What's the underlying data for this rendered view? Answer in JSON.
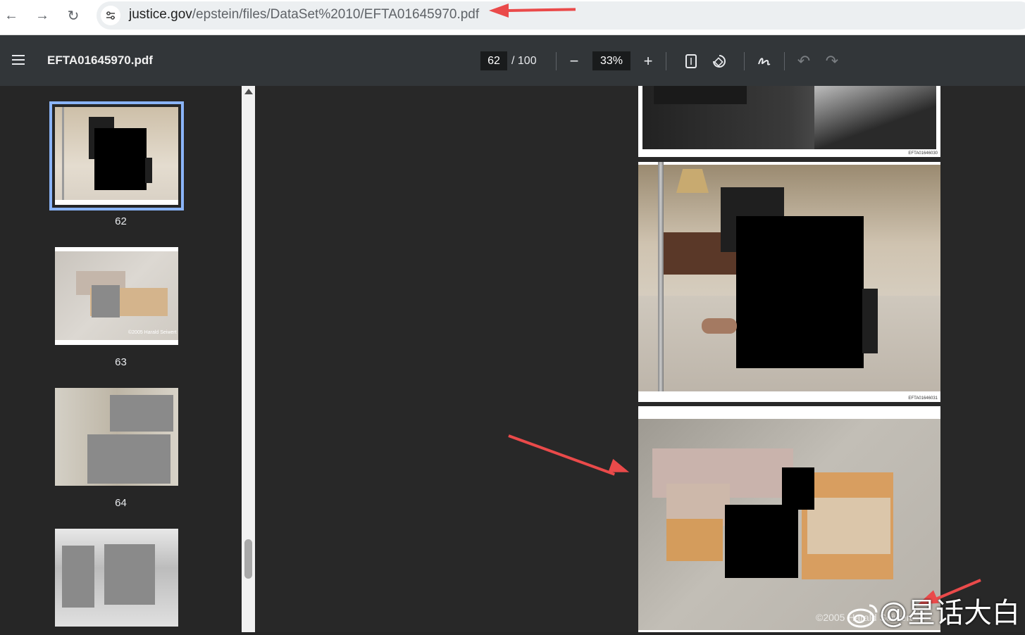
{
  "browser": {
    "url_domain": "justice.gov",
    "url_path": "/epstein/files/DataSet%2010/EFTA01645970.pdf",
    "back_icon": "arrow-left",
    "forward_icon": "arrow-right",
    "reload_icon": "reload",
    "site_info_icon": "tune"
  },
  "viewer": {
    "title": "EFTA01645970.pdf",
    "current_page": "62",
    "total_pages": "/ 100",
    "zoom": "33%",
    "zoom_out_icon": "minus",
    "zoom_in_icon": "plus",
    "fit_icon": "fit-page",
    "rotate_icon": "rotate",
    "annotate_icon": "draw",
    "undo_icon": "undo",
    "redo_icon": "redo"
  },
  "thumbnails": [
    {
      "label": "62",
      "selected": true
    },
    {
      "label": "63",
      "selected": false
    },
    {
      "label": "64",
      "selected": false
    },
    {
      "label": "",
      "selected": false
    }
  ],
  "thumbnail_caption_63": "©2005 Harald Seiwert",
  "pages": [
    {
      "code": "EFTA01646030"
    },
    {
      "code": "EFTA01646031"
    },
    {
      "code": ""
    }
  ],
  "page3_copyright": "©2005 Harald Seiwert",
  "watermark": "@星话大白",
  "annotation_color": "#ea4a4a",
  "accent_color": "#8ab4f8"
}
